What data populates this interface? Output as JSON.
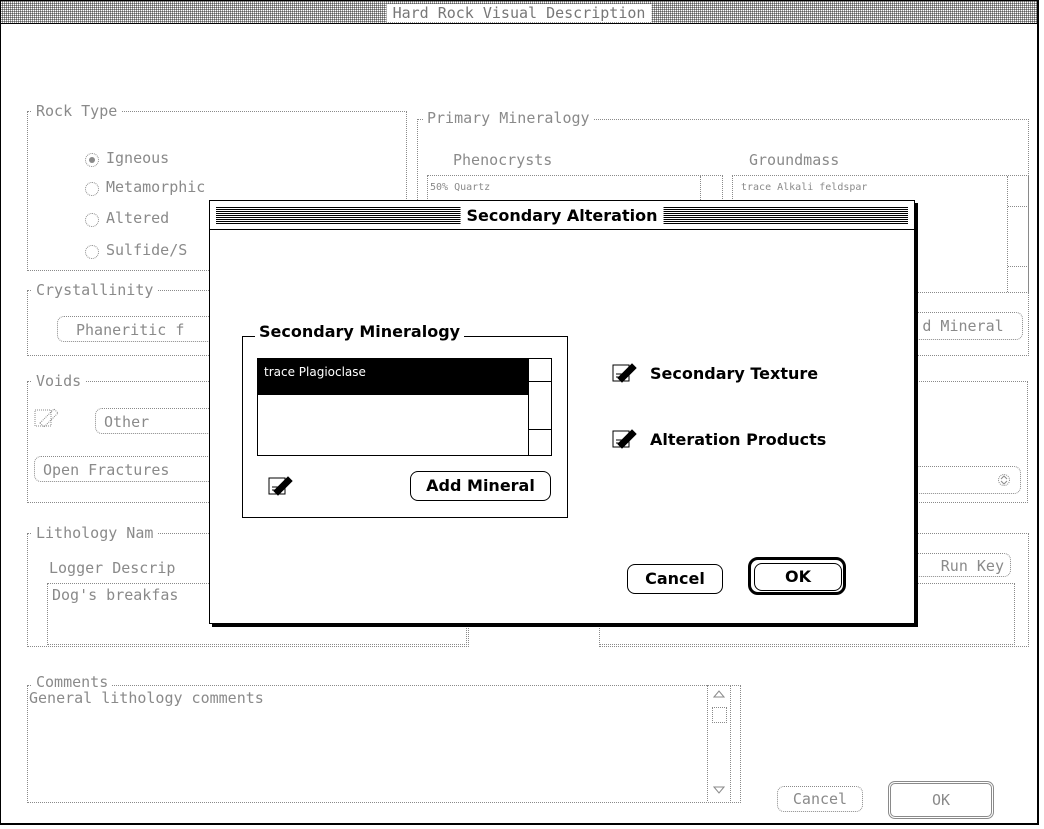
{
  "window": {
    "title": "Hard Rock Visual Description"
  },
  "rock_type": {
    "label": "Rock Type",
    "options": [
      "Igneous",
      "Metamorphic",
      "Altered",
      "Sulfide/S"
    ],
    "selected": "Igneous"
  },
  "primary_mineralogy": {
    "label": "Primary Mineralogy",
    "phenocrysts_label": "Phenocrysts",
    "groundmass_label": "Groundmass",
    "phenocrysts_items": [
      "50% Quartz"
    ],
    "groundmass_items": [
      "trace Alkali feldspar"
    ],
    "add_mineral_label": "d Mineral"
  },
  "crystallinity": {
    "label": "Crystallinity",
    "value": "Phaneritic  f"
  },
  "voids": {
    "label": "Voids",
    "type_value": "Other",
    "fracture_value": "Open Fractures"
  },
  "lithology": {
    "label": "Lithology Nam",
    "logger_label": "Logger Descrip",
    "logger_value": "Dog's breakfas",
    "run_key_label": "Run Key"
  },
  "comments": {
    "label": "Comments",
    "value": "General lithology comments"
  },
  "main_buttons": {
    "cancel": "Cancel",
    "ok": "OK"
  },
  "dialog": {
    "title": "Secondary Alteration",
    "secondary_mineralogy_label": "Secondary Mineralogy",
    "mineral_items": [
      "trace Plagioclase"
    ],
    "add_mineral": "Add Mineral",
    "secondary_texture": "Secondary Texture",
    "alteration_products": "Alteration Products",
    "cancel": "Cancel",
    "ok": "OK"
  },
  "icons": [
    "pencil-edit-icon",
    "scroll-up-arrow-icon",
    "scroll-down-arrow-icon",
    "popup-arrows-icon"
  ]
}
